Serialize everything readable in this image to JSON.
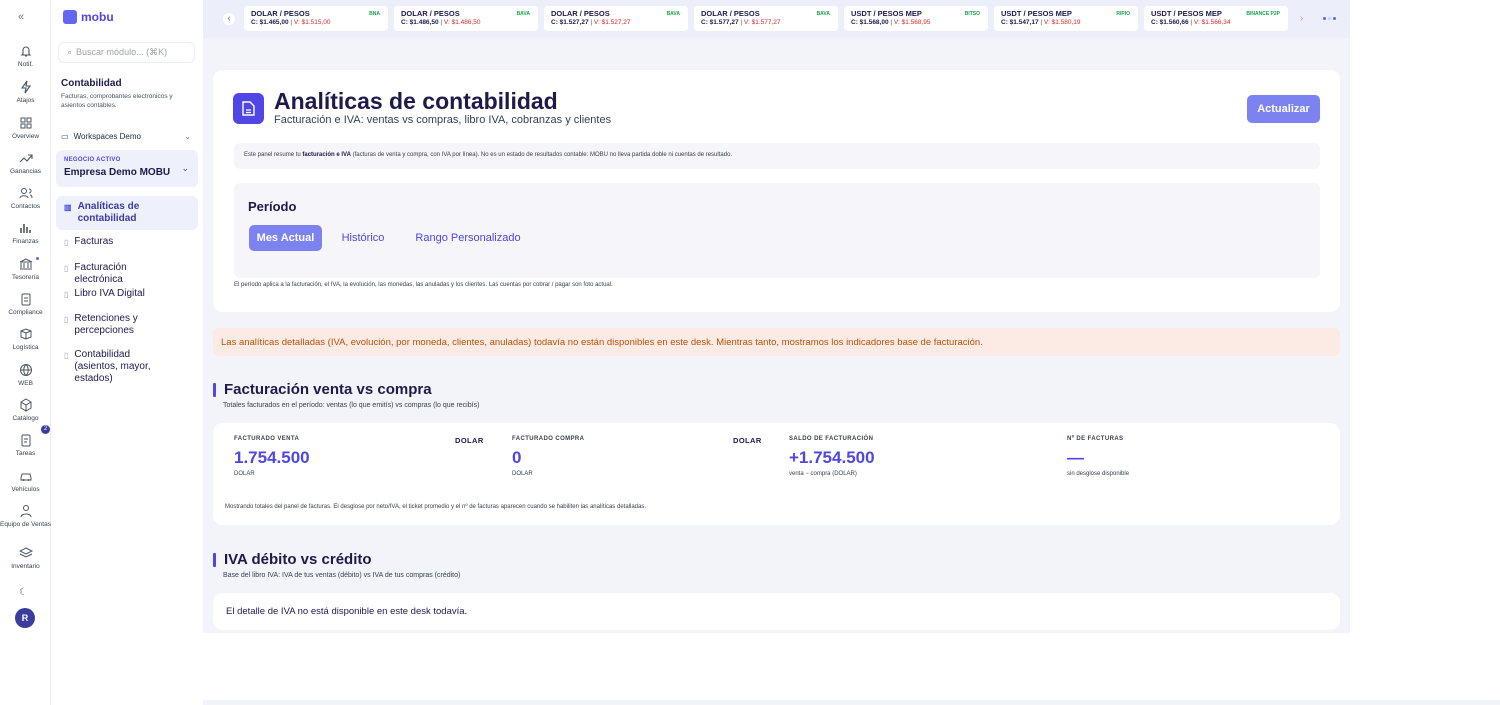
{
  "rail": {
    "items": [
      {
        "label": "Notif.",
        "icon": "bell-icon"
      },
      {
        "label": "Atajos",
        "icon": "lightning-icon"
      },
      {
        "label": "Overview",
        "icon": "grid-icon"
      },
      {
        "label": "Ganancias",
        "icon": "trend-up-icon"
      },
      {
        "label": "Contactos",
        "icon": "users-icon"
      },
      {
        "label": "Finanzas",
        "icon": "bar-chart-icon"
      },
      {
        "label": "Tesorería",
        "icon": "bank-icon"
      },
      {
        "label": "Compliance",
        "icon": "clipboard-icon"
      },
      {
        "label": "Logística",
        "icon": "box-icon"
      },
      {
        "label": "WEB",
        "icon": "globe-icon"
      },
      {
        "label": "Catálogo",
        "icon": "package-icon"
      },
      {
        "label": "Tareas",
        "icon": "tasks-icon"
      },
      {
        "label": "Vehículos",
        "icon": "car-icon"
      },
      {
        "label": "Equipo de Ventas",
        "icon": "team-icon"
      },
      {
        "label": "Inventario",
        "icon": "layers-icon"
      }
    ],
    "tasks_badge": "2",
    "avatar": "R"
  },
  "sidebar": {
    "logo": "mobu",
    "search_placeholder": "Buscar módulo... (⌘K)",
    "title": "Contabilidad",
    "subtitle": "Facturas, comprobantes electrónicos y asientos contables.",
    "workspace": "Workspaces Demo",
    "business_label": "NEGOCIO ACTIVO",
    "business_name": "Empresa Demo MOBU",
    "nav": [
      {
        "label": "Analíticas de contabilidad",
        "active": true
      },
      {
        "label": "Facturas"
      },
      {
        "label": "Facturación electrónica"
      },
      {
        "label": "Libro IVA Digital"
      },
      {
        "label": "Retenciones y percepciones"
      },
      {
        "label": "Contabilidad (asientos, mayor, estados)"
      }
    ]
  },
  "ticker": [
    {
      "pair": "DOLAR / PESOS",
      "source": "BNA",
      "buy": "C: $1.465,00",
      "sell": "V: $1.515,00"
    },
    {
      "pair": "DOLAR / PESOS",
      "source": "BAVA",
      "buy": "C: $1.486,50",
      "sell": "V: $1.486,50"
    },
    {
      "pair": "DOLAR / PESOS",
      "source": "BAVA",
      "buy": "C: $1.527,27",
      "sell": "V: $1.527,27"
    },
    {
      "pair": "DOLAR / PESOS",
      "source": "BAVA",
      "buy": "C: $1.577,27",
      "sell": "V: $1.577,27"
    },
    {
      "pair": "USDT / PESOS MEP",
      "source": "BITSO",
      "buy": "C: $1.568,00",
      "sell": "V: $1.568,95"
    },
    {
      "pair": "USDT / PESOS MEP",
      "source": "RIPIO",
      "buy": "C: $1.547,17",
      "sell": "V: $1.580,19"
    },
    {
      "pair": "USDT / PESOS MEP",
      "source": "BINANCE P2P",
      "buy": "C: $1.560,66",
      "sell": "V: $1.566,34"
    }
  ],
  "header": {
    "title": "Analíticas de contabilidad",
    "subtitle": "Facturación e IVA: ventas vs compras, libro IVA, cobranzas y clientes",
    "update_button": "Actualizar",
    "note_prefix": "Este panel resume tu",
    "note_bold": "facturación e IVA",
    "note_rest": "(facturas de venta y compra, con IVA por línea). No es un estado de resultados contable: MOBU no lleva partida doble ni cuentas de resultado."
  },
  "period": {
    "title": "Período",
    "options": [
      "Mes Actual",
      "Histórico",
      "Rango Personalizado"
    ],
    "selected": "Mes Actual",
    "note": "El período aplica a la facturación, el IVA, la evolución, las monedas, las anuladas y los clientes. Las cuentas por cobrar / pagar son foto actual."
  },
  "banner": "Las analíticas detalladas (IVA, evolución, por moneda, clientes, anuladas) todavía no están disponibles en este desk. Mientras tanto, mostramos los indicadores base de facturación.",
  "billing": {
    "title": "Facturación venta vs compra",
    "subtitle": "Totales facturados en el período: ventas (lo que emitís) vs compras (lo que recibís)",
    "kpis": [
      {
        "label": "FACTURADO VENTA",
        "currency": "DOLAR",
        "value": "1.754.500",
        "unit": "DOLAR"
      },
      {
        "label": "FACTURADO COMPRA",
        "currency": "DOLAR",
        "value": "0",
        "unit": "DOLAR"
      },
      {
        "label": "SALDO DE FACTURACIÓN",
        "currency": "",
        "value": "+1.754.500",
        "unit": "venta − compra (DOLAR)"
      },
      {
        "label": "Nº DE FACTURAS",
        "currency": "",
        "value": "—",
        "unit": "sin desglose disponible"
      }
    ],
    "footer": "Mostrando totales del panel de facturas. El desglose por neto/IVA, el ticket promedio y el nº de facturas aparecen cuando se habiliten las analíticas detalladas."
  },
  "iva": {
    "title": "IVA débito vs crédito",
    "subtitle": "Base del libro IVA: IVA de tus ventas (débito) vs IVA de tus compras (crédito)",
    "message": "El detalle de IVA no está disponible en este desk todavía."
  },
  "colors": {
    "accent": "#4f46e5",
    "button": "#7c82f0",
    "banner_bg": "#fcebe4",
    "banner_text": "#b45309"
  }
}
